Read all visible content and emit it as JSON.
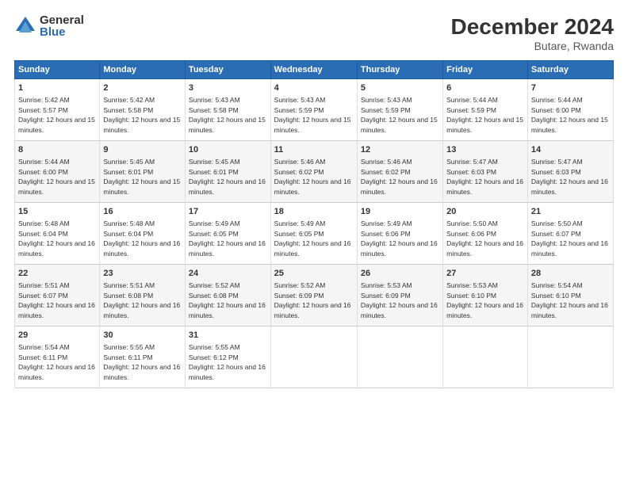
{
  "header": {
    "logo_general": "General",
    "logo_blue": "Blue",
    "month_title": "December 2024",
    "location": "Butare, Rwanda"
  },
  "days_of_week": [
    "Sunday",
    "Monday",
    "Tuesday",
    "Wednesday",
    "Thursday",
    "Friday",
    "Saturday"
  ],
  "weeks": [
    [
      {
        "day": "1",
        "sunrise": "Sunrise: 5:42 AM",
        "sunset": "Sunset: 5:57 PM",
        "daylight": "Daylight: 12 hours and 15 minutes."
      },
      {
        "day": "2",
        "sunrise": "Sunrise: 5:42 AM",
        "sunset": "Sunset: 5:58 PM",
        "daylight": "Daylight: 12 hours and 15 minutes."
      },
      {
        "day": "3",
        "sunrise": "Sunrise: 5:43 AM",
        "sunset": "Sunset: 5:58 PM",
        "daylight": "Daylight: 12 hours and 15 minutes."
      },
      {
        "day": "4",
        "sunrise": "Sunrise: 5:43 AM",
        "sunset": "Sunset: 5:59 PM",
        "daylight": "Daylight: 12 hours and 15 minutes."
      },
      {
        "day": "5",
        "sunrise": "Sunrise: 5:43 AM",
        "sunset": "Sunset: 5:59 PM",
        "daylight": "Daylight: 12 hours and 15 minutes."
      },
      {
        "day": "6",
        "sunrise": "Sunrise: 5:44 AM",
        "sunset": "Sunset: 5:59 PM",
        "daylight": "Daylight: 12 hours and 15 minutes."
      },
      {
        "day": "7",
        "sunrise": "Sunrise: 5:44 AM",
        "sunset": "Sunset: 6:00 PM",
        "daylight": "Daylight: 12 hours and 15 minutes."
      }
    ],
    [
      {
        "day": "8",
        "sunrise": "Sunrise: 5:44 AM",
        "sunset": "Sunset: 6:00 PM",
        "daylight": "Daylight: 12 hours and 15 minutes."
      },
      {
        "day": "9",
        "sunrise": "Sunrise: 5:45 AM",
        "sunset": "Sunset: 6:01 PM",
        "daylight": "Daylight: 12 hours and 15 minutes."
      },
      {
        "day": "10",
        "sunrise": "Sunrise: 5:45 AM",
        "sunset": "Sunset: 6:01 PM",
        "daylight": "Daylight: 12 hours and 16 minutes."
      },
      {
        "day": "11",
        "sunrise": "Sunrise: 5:46 AM",
        "sunset": "Sunset: 6:02 PM",
        "daylight": "Daylight: 12 hours and 16 minutes."
      },
      {
        "day": "12",
        "sunrise": "Sunrise: 5:46 AM",
        "sunset": "Sunset: 6:02 PM",
        "daylight": "Daylight: 12 hours and 16 minutes."
      },
      {
        "day": "13",
        "sunrise": "Sunrise: 5:47 AM",
        "sunset": "Sunset: 6:03 PM",
        "daylight": "Daylight: 12 hours and 16 minutes."
      },
      {
        "day": "14",
        "sunrise": "Sunrise: 5:47 AM",
        "sunset": "Sunset: 6:03 PM",
        "daylight": "Daylight: 12 hours and 16 minutes."
      }
    ],
    [
      {
        "day": "15",
        "sunrise": "Sunrise: 5:48 AM",
        "sunset": "Sunset: 6:04 PM",
        "daylight": "Daylight: 12 hours and 16 minutes."
      },
      {
        "day": "16",
        "sunrise": "Sunrise: 5:48 AM",
        "sunset": "Sunset: 6:04 PM",
        "daylight": "Daylight: 12 hours and 16 minutes."
      },
      {
        "day": "17",
        "sunrise": "Sunrise: 5:49 AM",
        "sunset": "Sunset: 6:05 PM",
        "daylight": "Daylight: 12 hours and 16 minutes."
      },
      {
        "day": "18",
        "sunrise": "Sunrise: 5:49 AM",
        "sunset": "Sunset: 6:05 PM",
        "daylight": "Daylight: 12 hours and 16 minutes."
      },
      {
        "day": "19",
        "sunrise": "Sunrise: 5:49 AM",
        "sunset": "Sunset: 6:06 PM",
        "daylight": "Daylight: 12 hours and 16 minutes."
      },
      {
        "day": "20",
        "sunrise": "Sunrise: 5:50 AM",
        "sunset": "Sunset: 6:06 PM",
        "daylight": "Daylight: 12 hours and 16 minutes."
      },
      {
        "day": "21",
        "sunrise": "Sunrise: 5:50 AM",
        "sunset": "Sunset: 6:07 PM",
        "daylight": "Daylight: 12 hours and 16 minutes."
      }
    ],
    [
      {
        "day": "22",
        "sunrise": "Sunrise: 5:51 AM",
        "sunset": "Sunset: 6:07 PM",
        "daylight": "Daylight: 12 hours and 16 minutes."
      },
      {
        "day": "23",
        "sunrise": "Sunrise: 5:51 AM",
        "sunset": "Sunset: 6:08 PM",
        "daylight": "Daylight: 12 hours and 16 minutes."
      },
      {
        "day": "24",
        "sunrise": "Sunrise: 5:52 AM",
        "sunset": "Sunset: 6:08 PM",
        "daylight": "Daylight: 12 hours and 16 minutes."
      },
      {
        "day": "25",
        "sunrise": "Sunrise: 5:52 AM",
        "sunset": "Sunset: 6:09 PM",
        "daylight": "Daylight: 12 hours and 16 minutes."
      },
      {
        "day": "26",
        "sunrise": "Sunrise: 5:53 AM",
        "sunset": "Sunset: 6:09 PM",
        "daylight": "Daylight: 12 hours and 16 minutes."
      },
      {
        "day": "27",
        "sunrise": "Sunrise: 5:53 AM",
        "sunset": "Sunset: 6:10 PM",
        "daylight": "Daylight: 12 hours and 16 minutes."
      },
      {
        "day": "28",
        "sunrise": "Sunrise: 5:54 AM",
        "sunset": "Sunset: 6:10 PM",
        "daylight": "Daylight: 12 hours and 16 minutes."
      }
    ],
    [
      {
        "day": "29",
        "sunrise": "Sunrise: 5:54 AM",
        "sunset": "Sunset: 6:11 PM",
        "daylight": "Daylight: 12 hours and 16 minutes."
      },
      {
        "day": "30",
        "sunrise": "Sunrise: 5:55 AM",
        "sunset": "Sunset: 6:11 PM",
        "daylight": "Daylight: 12 hours and 16 minutes."
      },
      {
        "day": "31",
        "sunrise": "Sunrise: 5:55 AM",
        "sunset": "Sunset: 6:12 PM",
        "daylight": "Daylight: 12 hours and 16 minutes."
      },
      null,
      null,
      null,
      null
    ]
  ]
}
